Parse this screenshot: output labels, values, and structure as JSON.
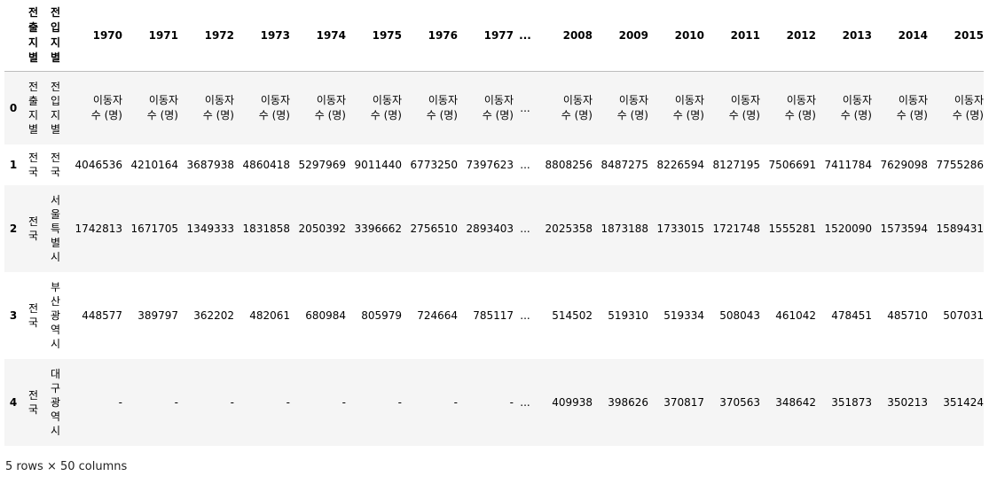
{
  "table": {
    "index_header": "",
    "col_out": "전출지별",
    "col_in": "전입지별",
    "years_left": [
      "1970",
      "1971",
      "1972",
      "1973",
      "1974",
      "1975",
      "1976",
      "1977"
    ],
    "ellipsis": "...",
    "years_right": [
      "2008",
      "2009",
      "2010",
      "2011",
      "2012",
      "2013",
      "2014",
      "2015"
    ],
    "rows": [
      {
        "idx": "0",
        "out": "전출지별",
        "in": "전입지별",
        "left": [
          "이동자\n수 (명)",
          "이동자\n수 (명)",
          "이동자\n수 (명)",
          "이동자\n수 (명)",
          "이동자\n수 (명)",
          "이동자\n수 (명)",
          "이동자\n수 (명)",
          "이동자\n수 (명)"
        ],
        "right": [
          "이동자\n수 (명)",
          "이동자\n수 (명)",
          "이동자\n수 (명)",
          "이동자\n수 (명)",
          "이동자\n수 (명)",
          "이동자\n수 (명)",
          "이동자\n수 (명)",
          "이동자\n수 (명)"
        ]
      },
      {
        "idx": "1",
        "out": "전국",
        "in": "전국",
        "left": [
          "4046536",
          "4210164",
          "3687938",
          "4860418",
          "5297969",
          "9011440",
          "6773250",
          "7397623"
        ],
        "right": [
          "8808256",
          "8487275",
          "8226594",
          "8127195",
          "7506691",
          "7411784",
          "7629098",
          "7755286"
        ]
      },
      {
        "idx": "2",
        "out": "전국",
        "in": "서울특별시",
        "left": [
          "1742813",
          "1671705",
          "1349333",
          "1831858",
          "2050392",
          "3396662",
          "2756510",
          "2893403"
        ],
        "right": [
          "2025358",
          "1873188",
          "1733015",
          "1721748",
          "1555281",
          "1520090",
          "1573594",
          "1589431"
        ]
      },
      {
        "idx": "3",
        "out": "전국",
        "in": "부산광역시",
        "left": [
          "448577",
          "389797",
          "362202",
          "482061",
          "680984",
          "805979",
          "724664",
          "785117"
        ],
        "right": [
          "514502",
          "519310",
          "519334",
          "508043",
          "461042",
          "478451",
          "485710",
          "507031"
        ]
      },
      {
        "idx": "4",
        "out": "전국",
        "in": "대구광역시",
        "left": [
          "-",
          "-",
          "-",
          "-",
          "-",
          "-",
          "-",
          "-"
        ],
        "right": [
          "409938",
          "398626",
          "370817",
          "370563",
          "348642",
          "351873",
          "350213",
          "351424"
        ]
      }
    ]
  },
  "footer": "5 rows × 50 columns"
}
